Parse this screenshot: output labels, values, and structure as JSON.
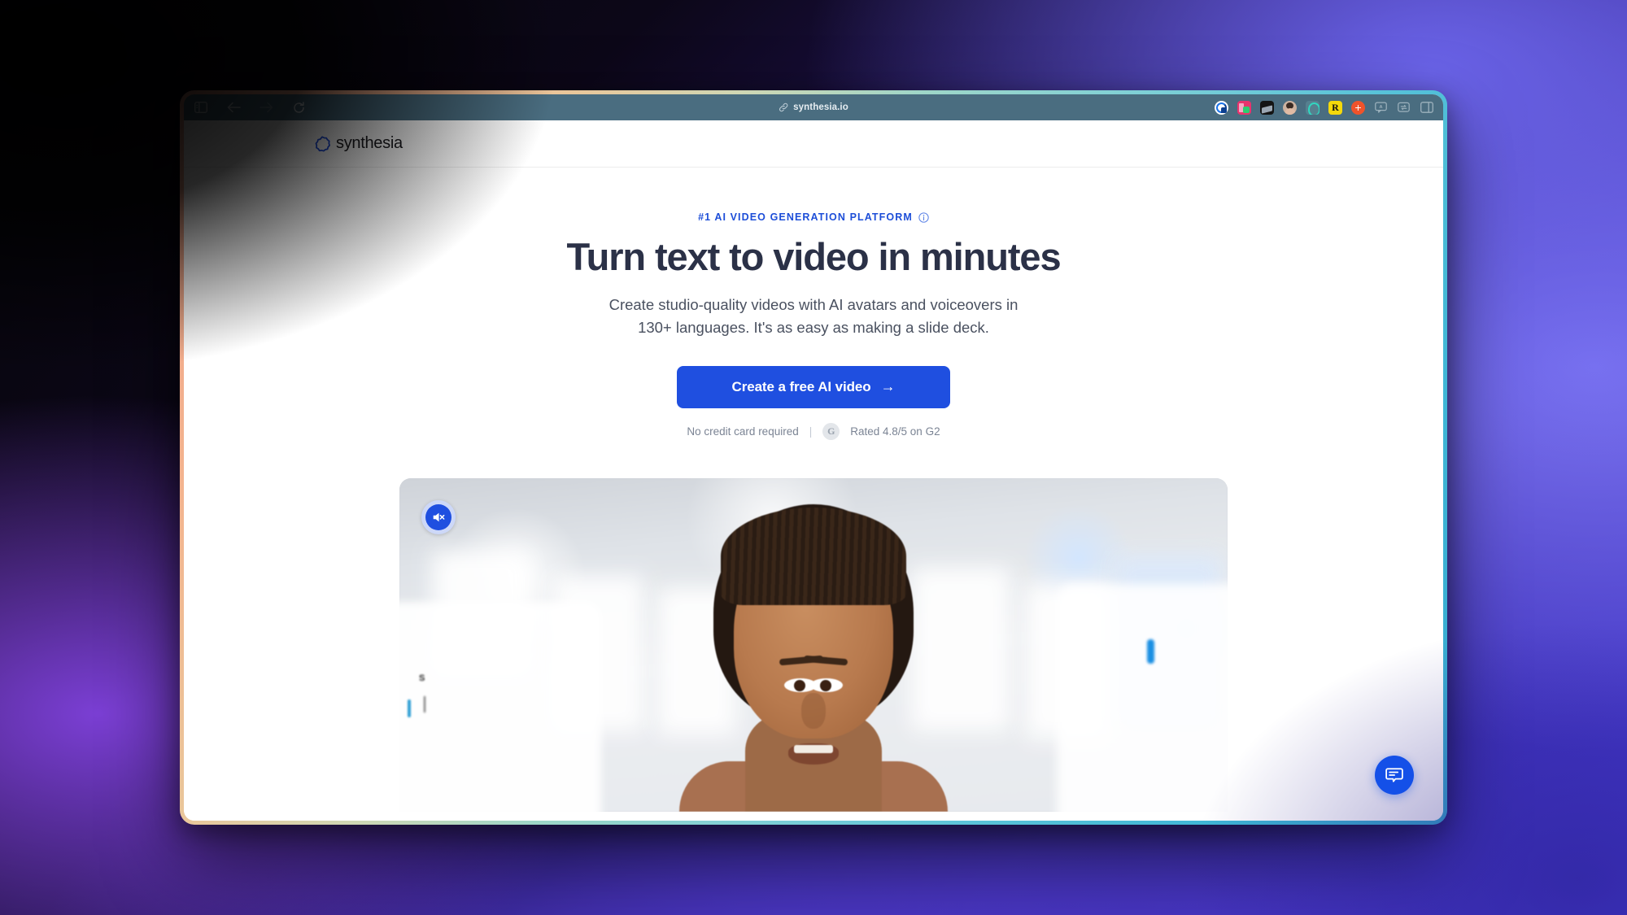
{
  "browser": {
    "url": "synthesia.io",
    "nav": {
      "sidebar_label": "Show sidebar",
      "back_label": "Back",
      "forward_label": "Forward",
      "reload_label": "Reload"
    },
    "extensions": [
      {
        "name": "grammarly-extension-icon",
        "label": ""
      },
      {
        "name": "pink-extension-icon",
        "label": ""
      },
      {
        "name": "dark-extension-icon",
        "label": ""
      },
      {
        "name": "profile-avatar-icon",
        "label": ""
      },
      {
        "name": "teal-extension-icon",
        "label": ""
      },
      {
        "name": "rakuten-extension-icon",
        "label": "R"
      },
      {
        "name": "add-extension-icon",
        "label": "+"
      },
      {
        "name": "comment-extension-icon",
        "label": ""
      },
      {
        "name": "share-extension-icon",
        "label": ""
      },
      {
        "name": "tab-overview-icon",
        "label": ""
      }
    ]
  },
  "site": {
    "logo_text": "synthesia"
  },
  "hero": {
    "eyebrow": "#1 AI VIDEO GENERATION PLATFORM",
    "headline": "Turn text to video in minutes",
    "subhead_line1": "Create studio-quality videos with AI avatars and voiceovers in",
    "subhead_line2": "130+ languages. It's as easy as making a slide deck.",
    "cta_label": "Create a free AI video",
    "cta_arrow": "→",
    "no_credit_card": "No credit card required",
    "separator": "|",
    "rating_text": "Rated 4.8/5 on G2",
    "g2_mark": "G"
  },
  "video": {
    "mute_label": "Unmute video",
    "overlay_text": "S"
  },
  "chat": {
    "label": "Open chat"
  },
  "colors": {
    "accent_blue": "#1f4fe0",
    "eyebrow_blue": "#1d4ed8",
    "headline_navy": "#2b3147",
    "toolbar": "#4a6d80",
    "chat_blue": "#1450e8"
  }
}
